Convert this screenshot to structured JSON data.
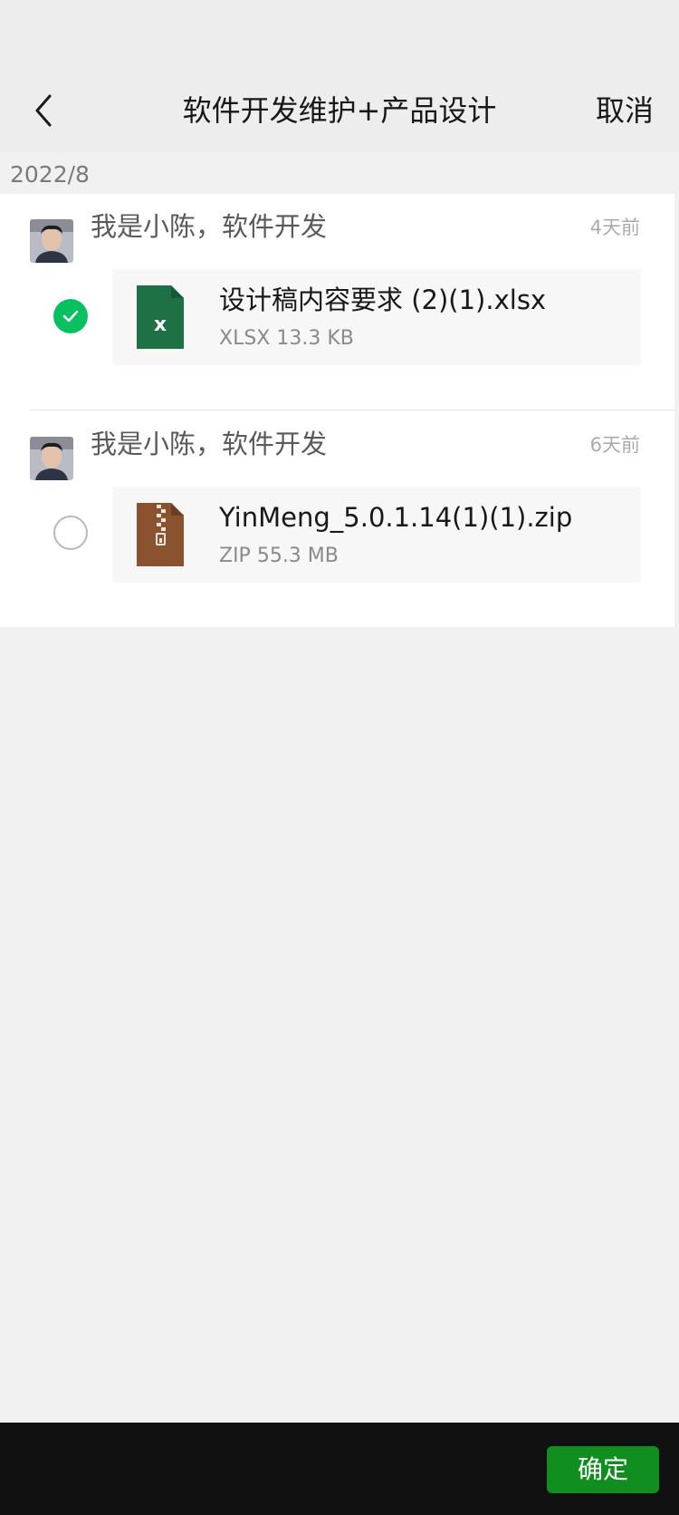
{
  "header": {
    "title": "软件开发维护+产品设计",
    "cancel_label": "取消",
    "back_icon": "chevron-left-icon"
  },
  "section": {
    "date": "2022/8"
  },
  "items": [
    {
      "sender": "我是小陈，软件开发",
      "time": "4天前",
      "file_name": "设计稿内容要求 (2)(1).xlsx",
      "file_meta": "XLSX 13.3 KB",
      "file_type": "xlsx",
      "icon_glyph": "X",
      "icon_color": "#1e7145",
      "selected": true
    },
    {
      "sender": "我是小陈，软件开发",
      "time": "6天前",
      "file_name": "YinMeng_5.0.1.14(1)(1).zip",
      "file_meta": "ZIP 55.3 MB",
      "file_type": "zip",
      "icon_color": "#8b5230",
      "selected": false
    }
  ],
  "footer": {
    "confirm_label": "确定"
  },
  "colors": {
    "accent_green": "#07c160",
    "confirm_button": "#108f20"
  }
}
